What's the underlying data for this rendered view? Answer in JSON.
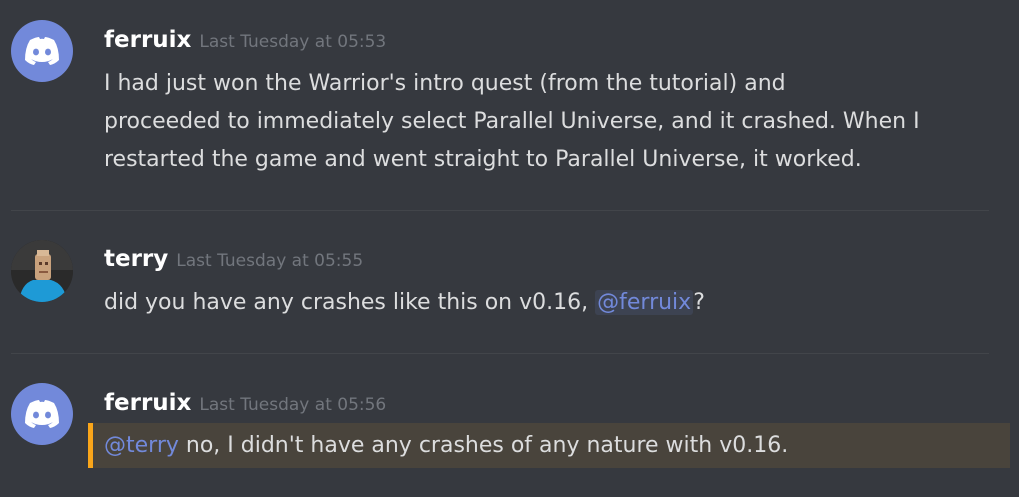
{
  "messages": [
    {
      "username": "ferruix",
      "timestamp": "Last Tuesday at 05:53",
      "avatar_icon": "discord-logo-icon",
      "lines": [
        "I had just won the Warrior's intro quest (from the tutorial) and",
        "proceeded to immediately select Parallel Universe, and it crashed. When I",
        "restarted the game and went straight to Parallel Universe, it worked."
      ]
    },
    {
      "username": "terry",
      "timestamp": "Last Tuesday at 05:55",
      "avatar_icon": "user-photo-avatar",
      "text_before": "did you have any crashes like this on v0.16, ",
      "mention": "@ferruix",
      "text_after": "?"
    },
    {
      "username": "ferruix",
      "timestamp": "Last Tuesday at 05:56",
      "avatar_icon": "discord-logo-icon",
      "mention": "@terry",
      "text_after": " no, I didn't have any crashes of any nature with v0.16."
    }
  ],
  "colors": {
    "background": "#36393f",
    "username": "#ffffff",
    "timestamp": "#72767d",
    "text": "#dcddde",
    "mention": "#7289da",
    "avatar_blurple": "#7289da",
    "mention_highlight_bar": "#faa61a",
    "mention_highlight_bg": "#49443c"
  }
}
